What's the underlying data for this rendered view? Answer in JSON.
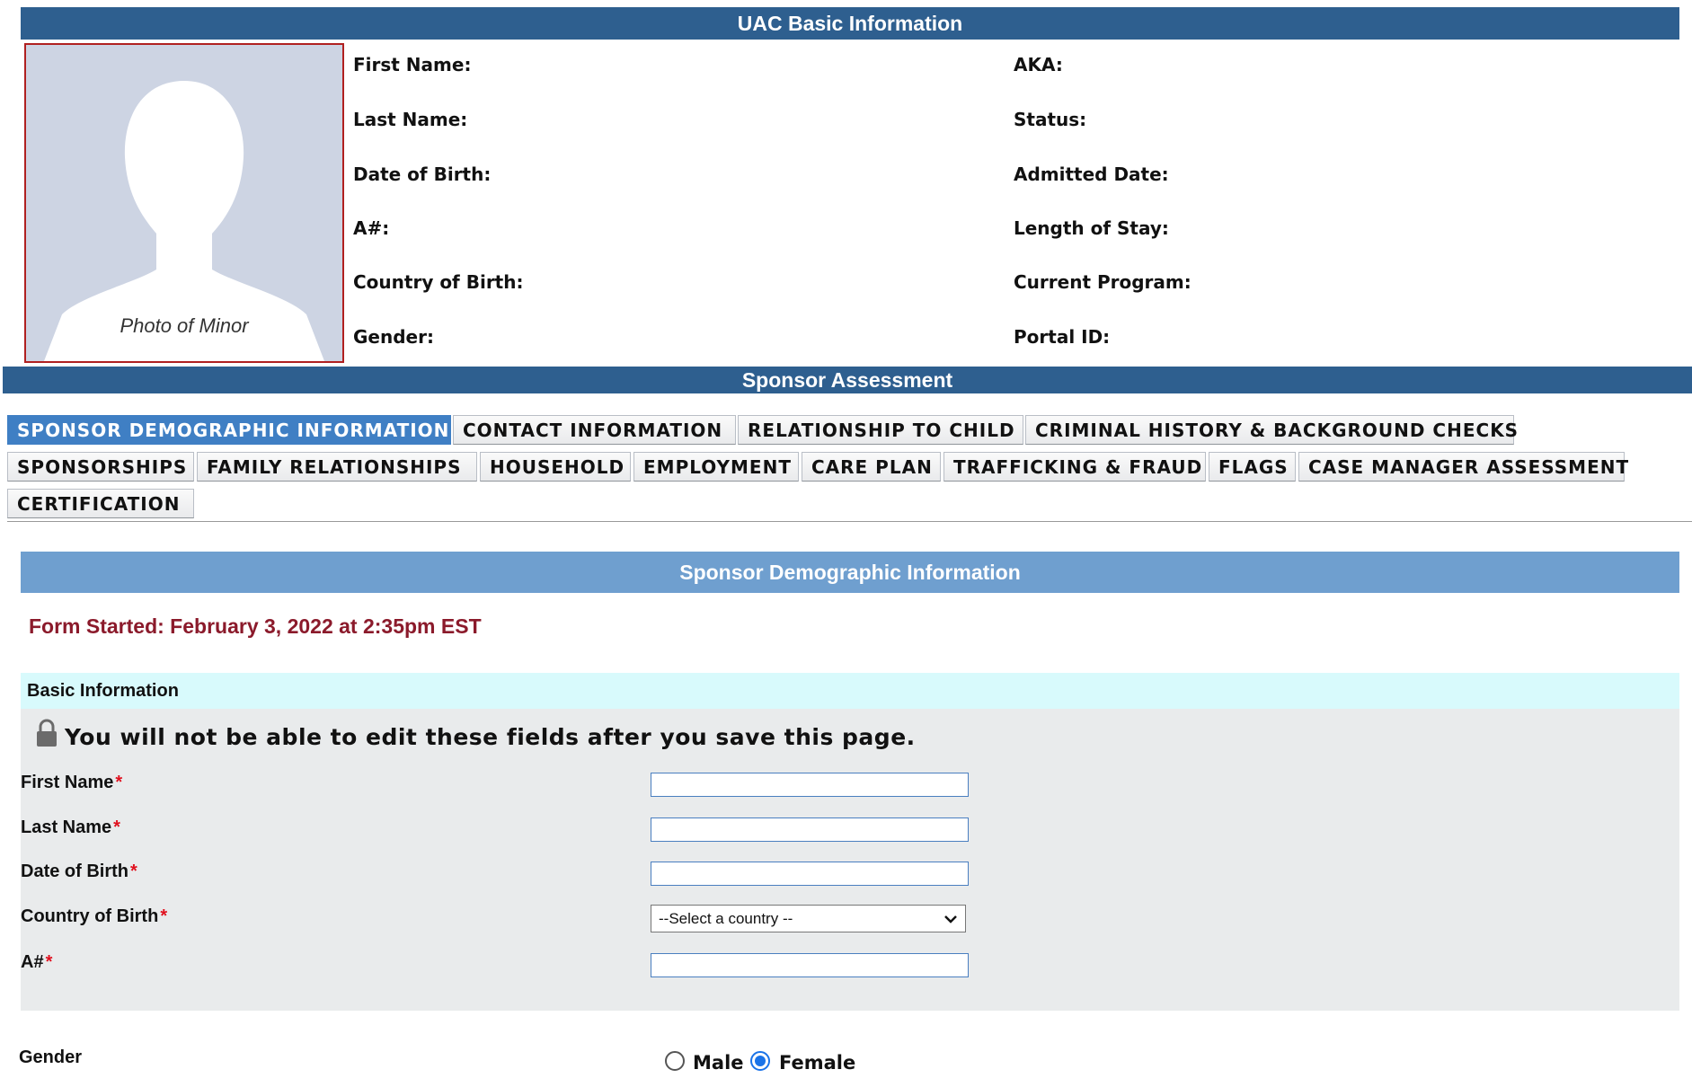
{
  "uac": {
    "title": "UAC Basic Information",
    "photo_caption": "Photo of Minor",
    "left_fields": [
      "First Name:",
      "Last Name:",
      "Date of Birth:",
      "A#:",
      "Country of Birth:",
      "Gender:"
    ],
    "right_fields": [
      "AKA:",
      "Status:",
      "Admitted Date:",
      "Length of Stay:",
      "Current Program:",
      "Portal ID:"
    ]
  },
  "sponsor": {
    "title": "Sponsor Assessment",
    "tabs": [
      "SPONSOR DEMOGRAPHIC INFORMATION",
      "CONTACT INFORMATION",
      "RELATIONSHIP TO CHILD",
      "CRIMINAL HISTORY & BACKGROUND CHECKS",
      "SPONSORSHIPS",
      "FAMILY RELATIONSHIPS",
      "HOUSEHOLD",
      "EMPLOYMENT",
      "CARE PLAN",
      "TRAFFICKING & FRAUD",
      "FLAGS",
      "CASE MANAGER ASSESSMENT",
      "CERTIFICATION"
    ],
    "active_tab": "SPONSOR DEMOGRAPHIC INFORMATION"
  },
  "section": {
    "title": "Sponsor Demographic Information",
    "form_started": "Form Started: February 3, 2022 at 2:35pm EST",
    "basic_info_title": "Basic Information",
    "lock_warning": "You will not be able to edit these fields after you save this page.",
    "required_mark": "*",
    "fields": {
      "first_name": "First Name",
      "last_name": "Last Name",
      "dob": "Date of Birth",
      "country": "Country of Birth",
      "anum": "A#"
    },
    "country_placeholder": "--Select a country --",
    "gender": {
      "label": "Gender",
      "options": [
        "Male",
        "Female"
      ],
      "selected": "Female"
    }
  },
  "colors": {
    "header_bar": "#2e5f8f",
    "section_bar": "#6f9fcf",
    "active_tab": "#3f7fc4",
    "form_started": "#8b1a2b",
    "required": "#e0101e",
    "basic_bar": "#d8fafc",
    "panel": "#e9ebec"
  }
}
